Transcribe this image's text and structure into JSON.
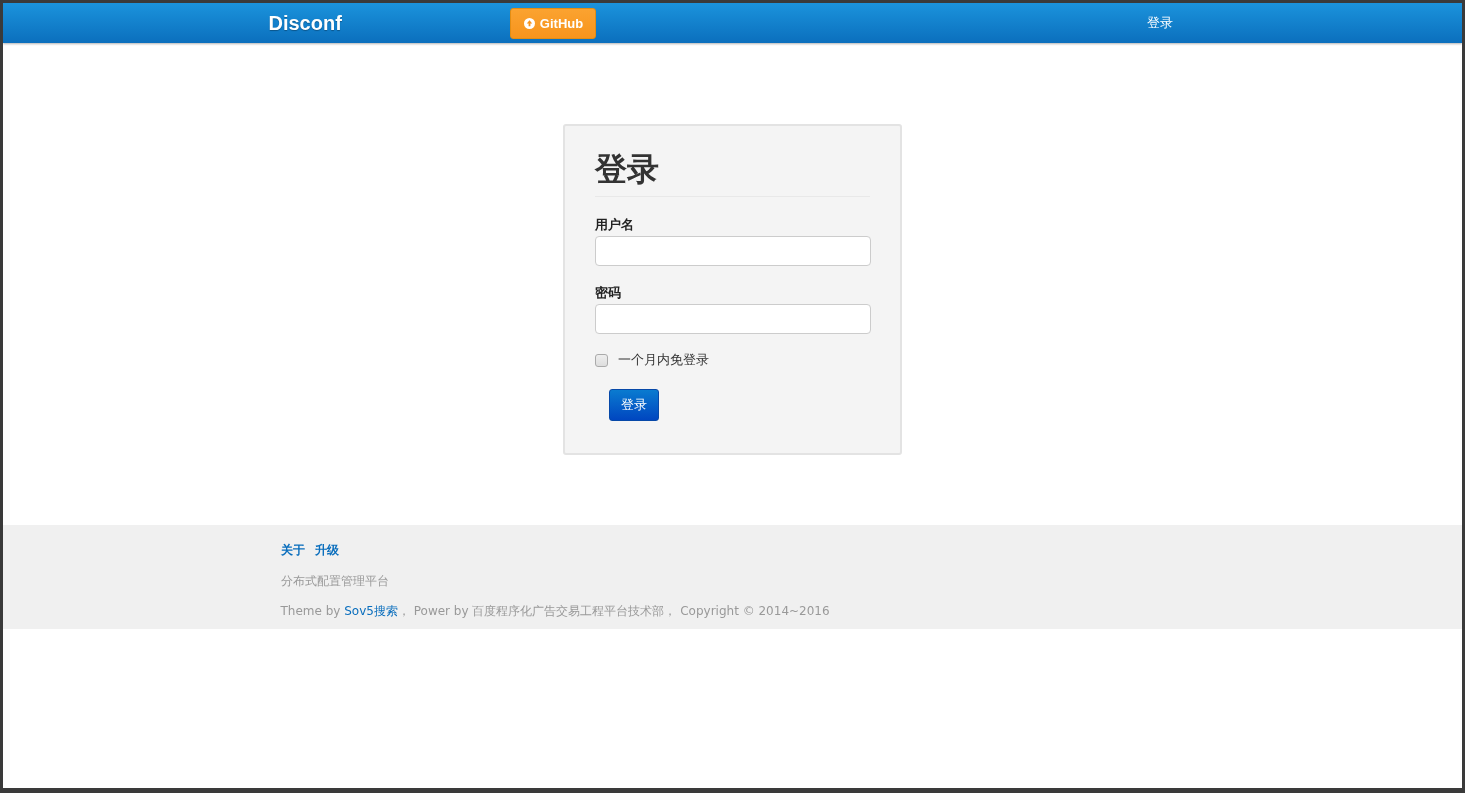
{
  "navbar": {
    "brand": "Disconf",
    "github_button": "GitHub",
    "login_link": "登录"
  },
  "login_form": {
    "title": "登录",
    "fields": [
      {
        "label": "用户名"
      },
      {
        "label": "密码"
      }
    ],
    "remember": {
      "label": "一个月内免登录",
      "checked": false
    },
    "submit": "登录"
  },
  "footer": {
    "links": [
      "关于",
      "升级"
    ],
    "tagline": "分布式配置管理平台",
    "credit": {
      "before": "Theme by ",
      "link": "Sov5搜索",
      "after": "， Power by 百度程序化广告交易工程平台技术部， Copyright © 2014~2016"
    }
  }
}
